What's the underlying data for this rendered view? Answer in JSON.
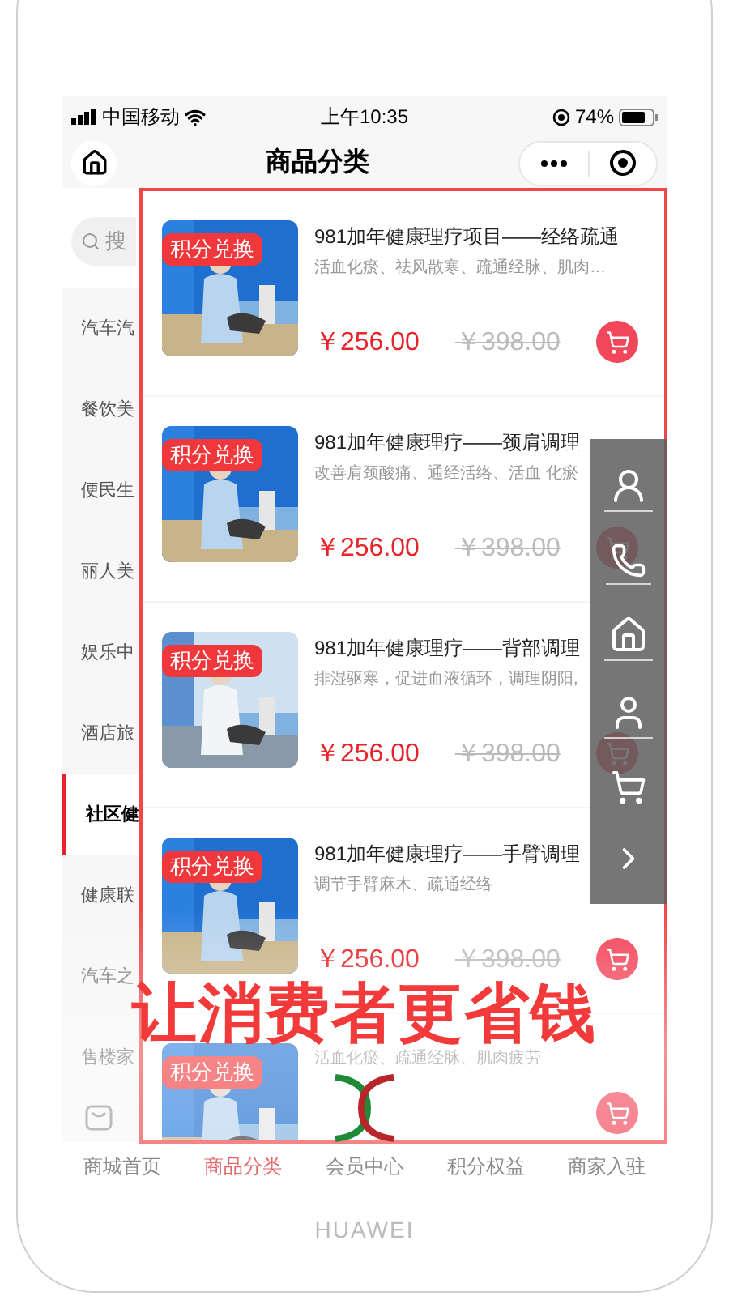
{
  "status_bar": {
    "carrier": "中国移动",
    "time": "上午10:35",
    "battery": "74%"
  },
  "nav": {
    "title": "商品分类"
  },
  "search": {
    "placeholder": "搜"
  },
  "categories": [
    {
      "label": "汽车汽",
      "selected": false
    },
    {
      "label": "餐饮美",
      "selected": false
    },
    {
      "label": "便民生",
      "selected": false
    },
    {
      "label": "丽人美",
      "selected": false
    },
    {
      "label": "娱乐中",
      "selected": false
    },
    {
      "label": "酒店旅",
      "selected": false
    },
    {
      "label": "社区健",
      "selected": true
    },
    {
      "label": "健康联",
      "selected": false
    },
    {
      "label": "汽车之",
      "selected": false
    },
    {
      "label": "售楼家",
      "selected": false
    }
  ],
  "products": [
    {
      "badge": "积分兑换",
      "title": "981加年健康理疗项目——经络疏通",
      "desc": "活血化瘀、祛风散寒、疏通经脉、肌肉…",
      "price": "￥256.00",
      "old_price": "￥398.00"
    },
    {
      "badge": "积分兑换",
      "title": "981加年健康理疗——颈肩调理",
      "desc": "改善肩颈酸痛、通经活络、活血 化瘀",
      "price": "￥256.00",
      "old_price": "￥398.00"
    },
    {
      "badge": "积分兑换",
      "title": "981加年健康理疗——背部调理",
      "desc": "排湿驱寒，促进血液循环，调理阴阳,",
      "price": "￥256.00",
      "old_price": "￥398.00"
    },
    {
      "badge": "积分兑换",
      "title": "981加年健康理疗——手臂调理",
      "desc": "调节手臂麻木、疏通经络",
      "price": "￥256.00",
      "old_price": "￥398.00"
    },
    {
      "badge": "积分兑换",
      "desc": "活血化瘀、疏通经脉、肌肉疲劳"
    }
  ],
  "tabs": [
    {
      "label": "商城首页",
      "selected": false
    },
    {
      "label": "商品分类",
      "selected": true
    },
    {
      "label": "会员中心",
      "selected": false
    },
    {
      "label": "积分权益",
      "selected": false
    },
    {
      "label": "商家入驻",
      "selected": false
    }
  ],
  "headline": "让消费者更省钱",
  "phone_brand": "HUAWEI"
}
